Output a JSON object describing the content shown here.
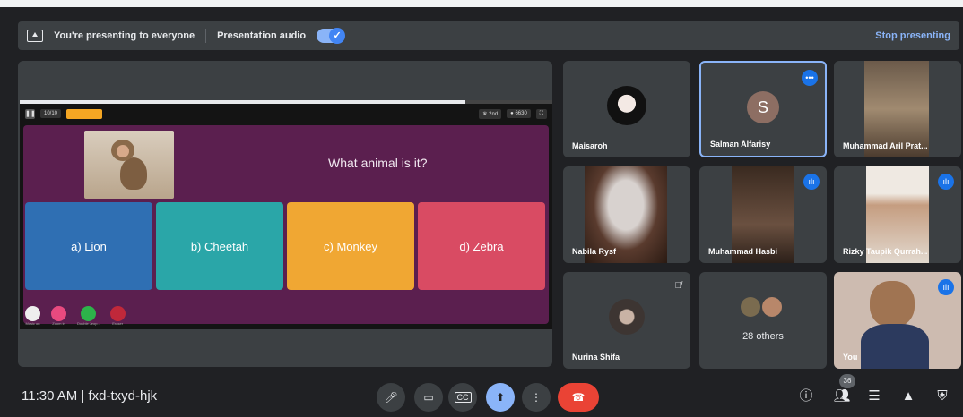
{
  "banner": {
    "presenting_text": "You're presenting to everyone",
    "audio_label": "Presentation audio",
    "stop_label": "Stop presenting"
  },
  "quiz": {
    "timer": "10/10",
    "rank": "2nd",
    "score": "6630",
    "question": "What animal is it?",
    "answers": [
      "a) Lion",
      "b) Cheetah",
      "c) Monkey",
      "d) Zebra"
    ],
    "answer_colors": [
      "#2f6fb3",
      "#2aa6a8",
      "#f0a733",
      "#d94b63"
    ],
    "powerups": [
      "Music on",
      "Zoom in",
      "Double Jeop..",
      "Eraser"
    ]
  },
  "participants": [
    {
      "name": "Maisaroh"
    },
    {
      "name": "Salman Alfarisy",
      "initial": "S"
    },
    {
      "name": "Muhammad Aril Prat..."
    },
    {
      "name": "Nabila Rysf"
    },
    {
      "name": "Muhammad Hasbi"
    },
    {
      "name": "Rizky Taupik Qurrah..."
    },
    {
      "name": "Nurina Shifa"
    },
    {
      "name": "28 others"
    },
    {
      "name": "You"
    }
  ],
  "bottom": {
    "time_and_code": "11:30 AM | fxd-txyd-hjk",
    "participant_count": "36"
  },
  "colors": {
    "accent": "#8ab4f8",
    "end_call": "#ea4335",
    "present_active": "#8ab4f8"
  }
}
